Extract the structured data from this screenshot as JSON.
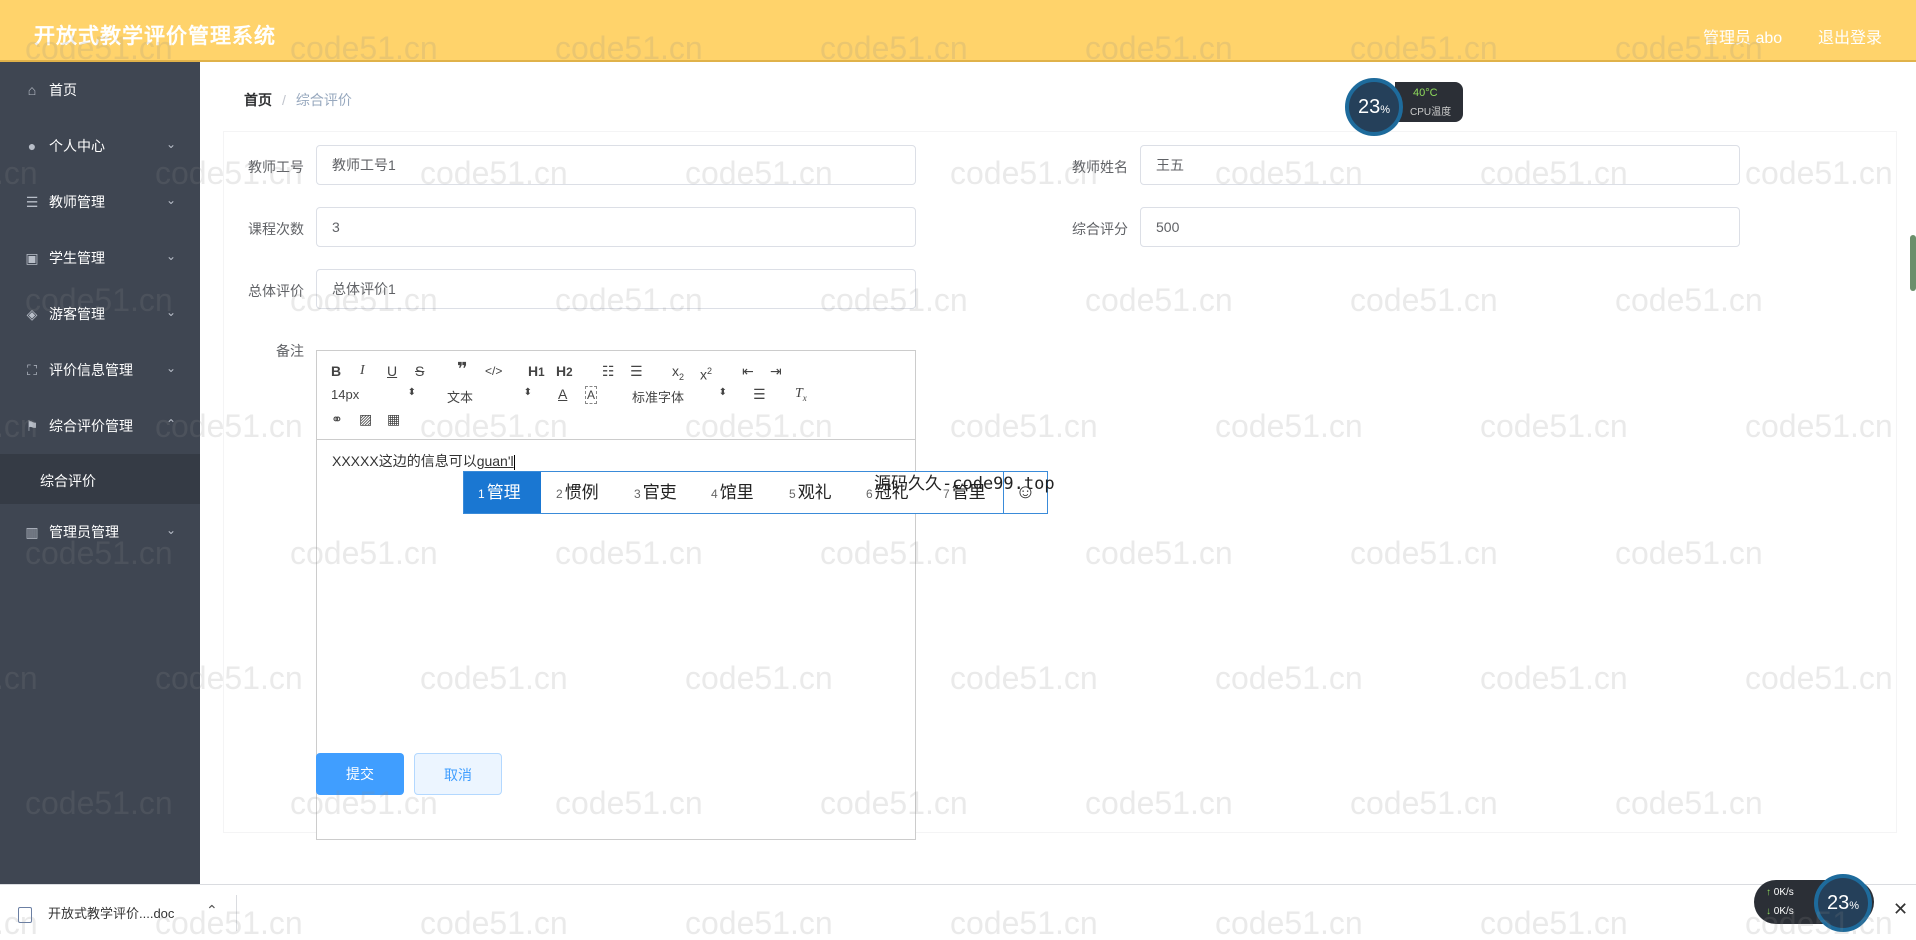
{
  "header": {
    "title": "开放式教学评价管理系统",
    "user": "管理员 abo",
    "logout": "退出登录"
  },
  "sidebar": {
    "items": [
      {
        "label": "首页",
        "icon": "home-icon"
      },
      {
        "label": "个人中心",
        "icon": "user-icon"
      },
      {
        "label": "教师管理",
        "icon": "list-icon"
      },
      {
        "label": "学生管理",
        "icon": "clipboard-icon"
      },
      {
        "label": "游客管理",
        "icon": "compass-icon"
      },
      {
        "label": "评价信息管理",
        "icon": "frame-icon"
      },
      {
        "label": "综合评价管理",
        "icon": "flag-icon"
      },
      {
        "label": "管理员管理",
        "icon": "bar-chart-icon"
      }
    ],
    "sub_item": "综合评价"
  },
  "breadcrumb": {
    "home": "首页",
    "separator": "/",
    "current": "综合评价"
  },
  "form": {
    "teacher_id_label": "教师工号",
    "teacher_id_value": "教师工号1",
    "teacher_name_label": "教师姓名",
    "teacher_name_value": "王五",
    "course_count_label": "课程次数",
    "course_count_value": "3",
    "score_label": "综合评分",
    "score_value": "500",
    "overall_label": "总体评价",
    "overall_value": "总体评价1",
    "remark_label": "备注"
  },
  "editor": {
    "font_size": "14px",
    "block_type": "文本",
    "font_family": "标准字体",
    "content_prefix": "XXXXX这边的信息可以",
    "content_composing": "guan'l"
  },
  "buttons": {
    "submit": "提交",
    "cancel": "取消"
  },
  "ime": {
    "candidates": [
      {
        "num": "1",
        "text": "管理"
      },
      {
        "num": "2",
        "text": "惯例"
      },
      {
        "num": "3",
        "text": "官吏"
      },
      {
        "num": "4",
        "text": "馆里"
      },
      {
        "num": "5",
        "text": "观礼"
      },
      {
        "num": "6",
        "text": "冠礼"
      },
      {
        "num": "7",
        "text": "管里"
      }
    ],
    "emoji": "☺"
  },
  "overlay_text": "源码久久-code99.top",
  "cpu_widget": {
    "percent": "23",
    "percent_unit": "%",
    "temp": "40°C",
    "label": "CPU温度"
  },
  "downloads": {
    "file_name": "开放式教学评价....doc"
  },
  "net_widget": {
    "up": "0K/s",
    "down": "0K/s",
    "percent": "23",
    "percent_unit": "%"
  },
  "watermark": "code51.cn",
  "colors": {
    "header": "#ffd36b",
    "sidebar": "#3f4652",
    "primary": "#409eff",
    "ime_selected": "#1a77d2"
  }
}
